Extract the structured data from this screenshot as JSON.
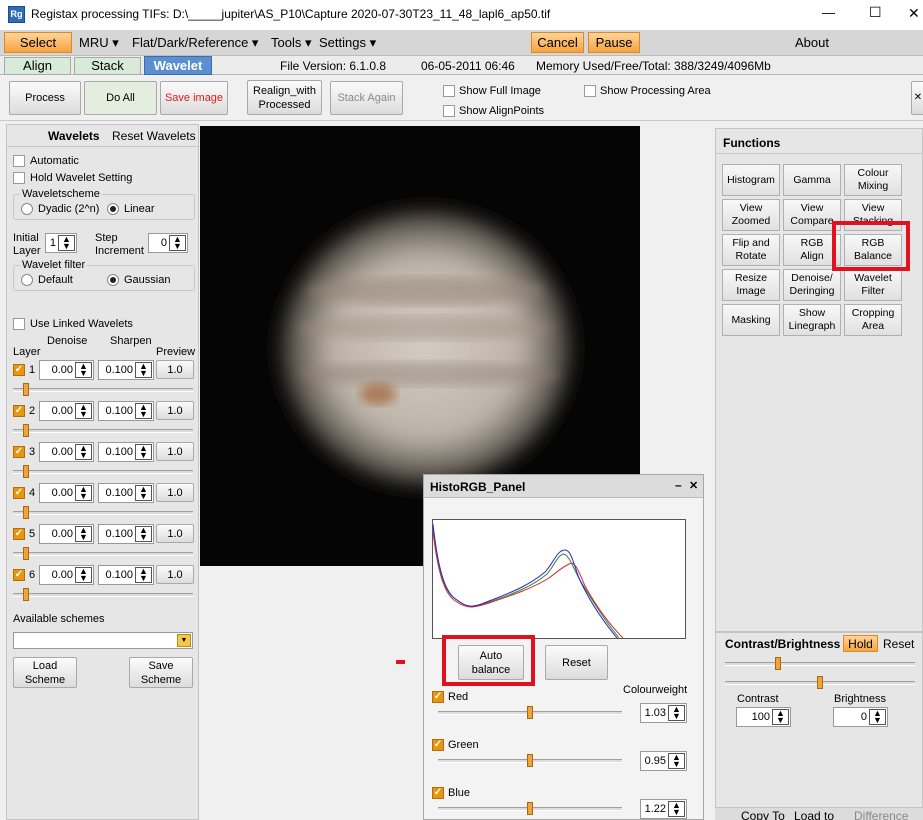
{
  "window": {
    "title": "Registax processing TIFs: D:\\_____jupiter\\AS_P10\\Capture 2020-07-30T23_11_48_lapl6_ap50.tif",
    "icon": "registax-icon",
    "controls": {
      "minimize": "—",
      "maximize": "☐",
      "close": "✕"
    }
  },
  "menu": {
    "select": "Select",
    "mru": "MRU ▾",
    "flat": "Flat/Dark/Reference ▾",
    "tools": "Tools ▾",
    "settings": "Settings ▾",
    "cancel": "Cancel",
    "pause": "Pause",
    "about": "About"
  },
  "tabs": {
    "align": "Align",
    "stack": "Stack",
    "wavelet": "Wavelet"
  },
  "status": {
    "file_version": "File Version: 6.1.0.8",
    "date": "06-05-2011 06:46",
    "memory": "Memory Used/Free/Total: 388/3249/4096Mb"
  },
  "toolbar": {
    "process": "Process",
    "do_all": "Do All",
    "save_image": "Save image",
    "realign_line1": "Realign_with",
    "realign_line2": "Processed",
    "stack_again": "Stack Again",
    "show_full_image": "Show Full Image",
    "show_alignpoints": "Show AlignPoints",
    "show_processing_area": "Show Processing Area",
    "close_x": "✕"
  },
  "wavelets": {
    "title": "Wavelets",
    "reset": "Reset Wavelets",
    "automatic": "Automatic",
    "hold": "Hold Wavelet Setting",
    "scheme_label": "Waveletscheme",
    "dyadic": "Dyadic (2^n)",
    "linear": "Linear",
    "initial": "Initial",
    "layer_word": "Layer",
    "initial_value": "1",
    "step": "Step",
    "increment": "Increment",
    "step_value": "0",
    "filter_label": "Wavelet filter",
    "default": "Default",
    "gaussian": "Gaussian",
    "use_linked": "Use Linked Wavelets",
    "col_layer": "Layer",
    "col_denoise": "Denoise",
    "col_sharpen": "Sharpen",
    "col_preview": "Preview",
    "layers": [
      {
        "num": "1",
        "denoise": "0.00",
        "sharpen": "0.100",
        "preview": "1.0"
      },
      {
        "num": "2",
        "denoise": "0.00",
        "sharpen": "0.100",
        "preview": "1.0"
      },
      {
        "num": "3",
        "denoise": "0.00",
        "sharpen": "0.100",
        "preview": "1.0"
      },
      {
        "num": "4",
        "denoise": "0.00",
        "sharpen": "0.100",
        "preview": "1.0"
      },
      {
        "num": "5",
        "denoise": "0.00",
        "sharpen": "0.100",
        "preview": "1.0"
      },
      {
        "num": "6",
        "denoise": "0.00",
        "sharpen": "0.100",
        "preview": "1.0"
      }
    ],
    "available_schemes": "Available schemes",
    "load1": "Load",
    "load2": "Scheme",
    "save1": "Save",
    "save2": "Scheme"
  },
  "functions": {
    "title": "Functions",
    "buttons": [
      [
        "Histogram"
      ],
      [
        "Gamma"
      ],
      [
        "Colour",
        "Mixing"
      ],
      [
        "View",
        "Zoomed"
      ],
      [
        "View",
        "Compare"
      ],
      [
        "View",
        "Stacking"
      ],
      [
        "Flip and",
        "Rotate"
      ],
      [
        "RGB",
        "Align"
      ],
      [
        "RGB",
        "Balance"
      ],
      [
        "Resize",
        "Image"
      ],
      [
        "Denoise/",
        "Deringing"
      ],
      [
        "Wavelet",
        "Filter"
      ],
      [
        "Masking"
      ],
      [
        "Show",
        "Linegraph"
      ],
      [
        "Cropping",
        "Area"
      ]
    ]
  },
  "contrast": {
    "title": "Contrast/Brightness",
    "hold": "Hold",
    "reset": "Reset",
    "contrast_label": "Contrast",
    "contrast_value": "100",
    "brightness_label": "Brightness",
    "brightness_value": "0",
    "contrast_slider_level": 0.28,
    "brightness_slider_level": 0.5
  },
  "bottom": {
    "copy_to": "Copy To",
    "load_to": "Load to",
    "difference": "Difference"
  },
  "histo_panel": {
    "title": "HistoRGB_Panel",
    "min": "–",
    "close": "✕",
    "auto_balance_1": "Auto",
    "auto_balance_2": "balance",
    "reset": "Reset",
    "colourweight": "Colourweight",
    "channels": [
      {
        "name": "Red",
        "value": "1.03",
        "level": 0.5
      },
      {
        "name": "Green",
        "value": "0.95",
        "level": 0.5
      },
      {
        "name": "Blue",
        "value": "1.22",
        "level": 0.5
      }
    ]
  },
  "colors": {
    "accent_orange": "#f7a33e",
    "highlight_red": "#e0121f",
    "tab_active": "#5b8fd0",
    "tab_inactive": "#d8ead8"
  }
}
